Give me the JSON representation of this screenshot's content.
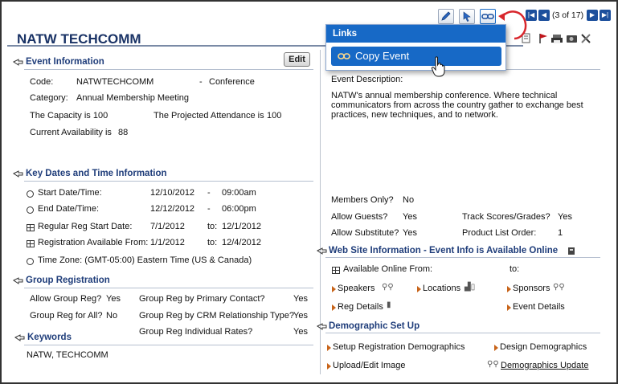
{
  "event": {
    "title": "NATW TECHCOMM",
    "edit_label": "Edit"
  },
  "pager": {
    "label": "(3 of 17)"
  },
  "links_popup": {
    "header": "Links",
    "item": "Copy Event"
  },
  "event_info": {
    "heading": "Event Information",
    "code_label": "Code:",
    "code_value": "NATWTECHCOMM",
    "code_sep": "-",
    "code_type": "Conference",
    "category_label": "Category:",
    "category_value": "Annual Membership Meeting",
    "capacity": "The Capacity is 100",
    "projected_label": "The Projected Attendance is",
    "projected_value": "100",
    "availability_label": "Current Availability is",
    "availability_value": "88"
  },
  "description": {
    "label": "Event Description:",
    "lines": [
      "NATW's annual membership conference. Where technical",
      "communicators from across the country gather to exchange best",
      "practices, new techniques, and to network."
    ]
  },
  "key_dates": {
    "heading": "Key Dates and Time Information",
    "start_label": "Start Date/Time:",
    "start_date": "12/10/2012",
    "start_sep": "-",
    "start_time": "09:00am",
    "end_label": "End Date/Time:",
    "end_date": "12/12/2012",
    "end_sep": "-",
    "end_time": "06:00pm",
    "reg_label": "Regular Reg Start Date:",
    "reg_from": "7/1/2012",
    "reg_to_label": "to:",
    "reg_to": "12/1/2012",
    "avail_label": "Registration Available From:",
    "avail_from": "1/1/2012",
    "avail_to_label": "to:",
    "avail_to": "12/4/2012",
    "timezone": "Time Zone: (GMT-05:00) Eastern Time (US & Canada)"
  },
  "flags": {
    "members_only_label": "Members Only?",
    "members_only_value": "No",
    "guests_label": "Allow Guests?",
    "guests_value": "Yes",
    "track_label": "Track Scores/Grades?",
    "track_value": "Yes",
    "substitute_label": "Allow Substitute?",
    "substitute_value": "Yes",
    "product_label": "Product List Order:",
    "product_value": "1"
  },
  "group_reg": {
    "heading": "Group Registration",
    "allow_label": "Allow Group Reg?",
    "allow_value": "Yes",
    "primary_label": "Group Reg by Primary Contact?",
    "primary_value": "Yes",
    "all_label": "Group Reg for All?",
    "all_value": "No",
    "crm_label": "Group Reg by CRM Relationship Type?",
    "crm_value": "Yes",
    "individual_label": "Group Reg Individual Rates?",
    "individual_value": "Yes"
  },
  "website": {
    "heading": "Web Site Information - Event Info is Available Online",
    "available_label": "Available Online From:",
    "to_label": "to:",
    "speakers": "Speakers",
    "locations": "Locations",
    "sponsors": "Sponsors",
    "reg_details": "Reg Details",
    "event_details": "Event Details"
  },
  "keywords": {
    "heading": "Keywords",
    "value": "NATW, TECHCOMM"
  },
  "demographics": {
    "heading": "Demographic Set Up",
    "setup": "Setup Registration Demographics",
    "design": "Design Demographics",
    "upload": "Upload/Edit Image",
    "update": "Demographics Update"
  },
  "colors": {
    "title": "#1a3366",
    "section_heading": "#1f3d7a",
    "popup_blue": "#1769c6",
    "bullet_orange": "#c8641a"
  }
}
